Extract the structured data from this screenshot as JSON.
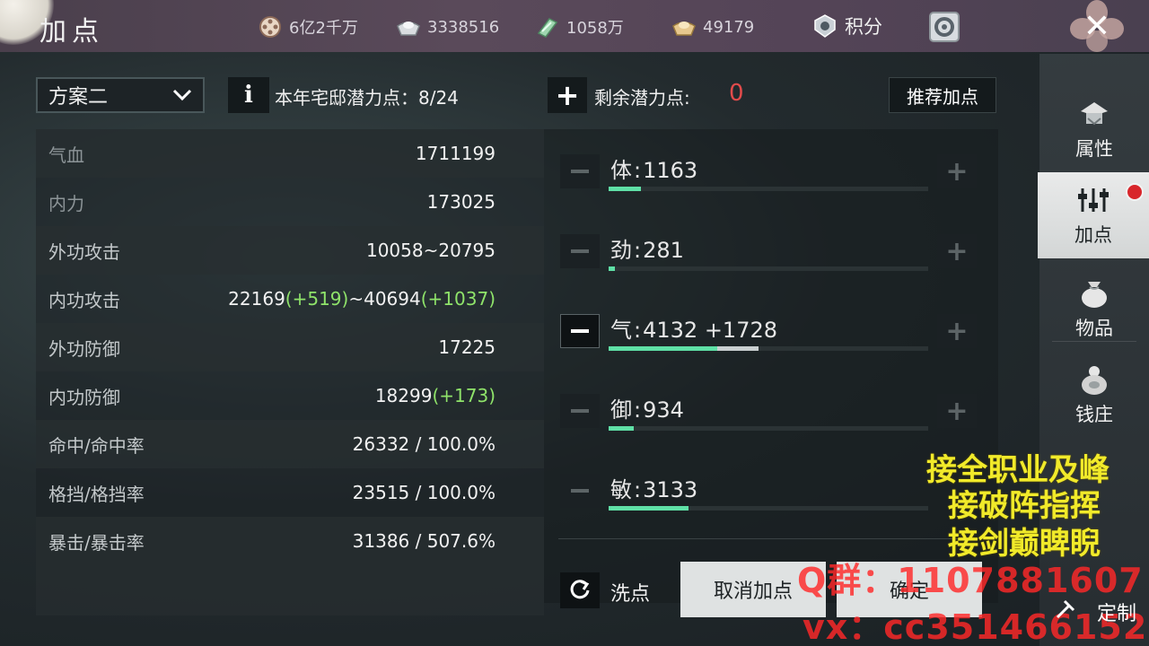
{
  "header": {
    "title": "加点",
    "resources": [
      {
        "icon": "film-reel-icon",
        "value": "6亿2千万"
      },
      {
        "icon": "silver-ingot-icon",
        "value": "3338516"
      },
      {
        "icon": "jade-icon",
        "value": "1058万"
      },
      {
        "icon": "gold-ingot-icon",
        "value": "49179"
      }
    ],
    "score_label": "积分",
    "close_label": "✕"
  },
  "controls": {
    "plan_selected": "方案二",
    "info_label": "i",
    "estate_points_label": "本年宅邸潜力点：8/24",
    "plus_label": "+",
    "remaining_label": "剩余潜力点:",
    "remaining_value": "0",
    "recommend_label": "推荐加点"
  },
  "stats": [
    {
      "name": "气血",
      "value": "1711199",
      "dim": true
    },
    {
      "name": "内力",
      "value": "173025",
      "dim": true
    },
    {
      "name": "外功攻击",
      "value": "10058~20795"
    },
    {
      "name": "内功攻击",
      "value_a": "22169",
      "bonus_a": "(+519)",
      "value_b": "~40694",
      "bonus_b": "(+1037)"
    },
    {
      "name": "外功防御",
      "value": "17225"
    },
    {
      "name": "内功防御",
      "value_a": "18299",
      "bonus_a": "(+173)"
    },
    {
      "name": "命中/命中率",
      "value": "26332 / 100.0%"
    },
    {
      "name": "格挡/格挡率",
      "value": "23515 / 100.0%"
    },
    {
      "name": "暴击/暴击率",
      "value": "31386 / 507.6%"
    }
  ],
  "attributes": [
    {
      "name": "体",
      "value": "1163",
      "bonus": "",
      "fill_pct": 10
    },
    {
      "name": "劲",
      "value": "281",
      "bonus": "",
      "fill_pct": 2
    },
    {
      "name": "气",
      "value": "4132",
      "bonus": "+1728",
      "fill_pct": 34,
      "bonus_pct": 13
    },
    {
      "name": "御",
      "value": "934",
      "bonus": "",
      "fill_pct": 8
    },
    {
      "name": "敏",
      "value": "3133",
      "bonus": "",
      "fill_pct": 25
    }
  ],
  "footer": {
    "reset_label": "洗点",
    "cancel_label": "取消加点",
    "confirm_label": "确定"
  },
  "tabs": [
    {
      "label": "属性",
      "icon": "hat-icon"
    },
    {
      "label": "加点",
      "icon": "sliders-icon",
      "active": true
    },
    {
      "label": "物品",
      "icon": "bag-icon"
    },
    {
      "label": "钱庄",
      "icon": "money-bag-icon"
    }
  ],
  "overlay": {
    "promo_lines": [
      "接全职业及峰",
      "接破阵指挥",
      "接剑巅睥睨"
    ],
    "qq_text": "Q群：1107881607",
    "vx_text": "vx：cc351466152",
    "custom_label": "定制"
  },
  "colors": {
    "accent_green": "#5fe0a6",
    "bonus_green": "#8fe36a",
    "remaining_red": "#e24b4b",
    "promo_yellow": "#f1ea2a"
  }
}
